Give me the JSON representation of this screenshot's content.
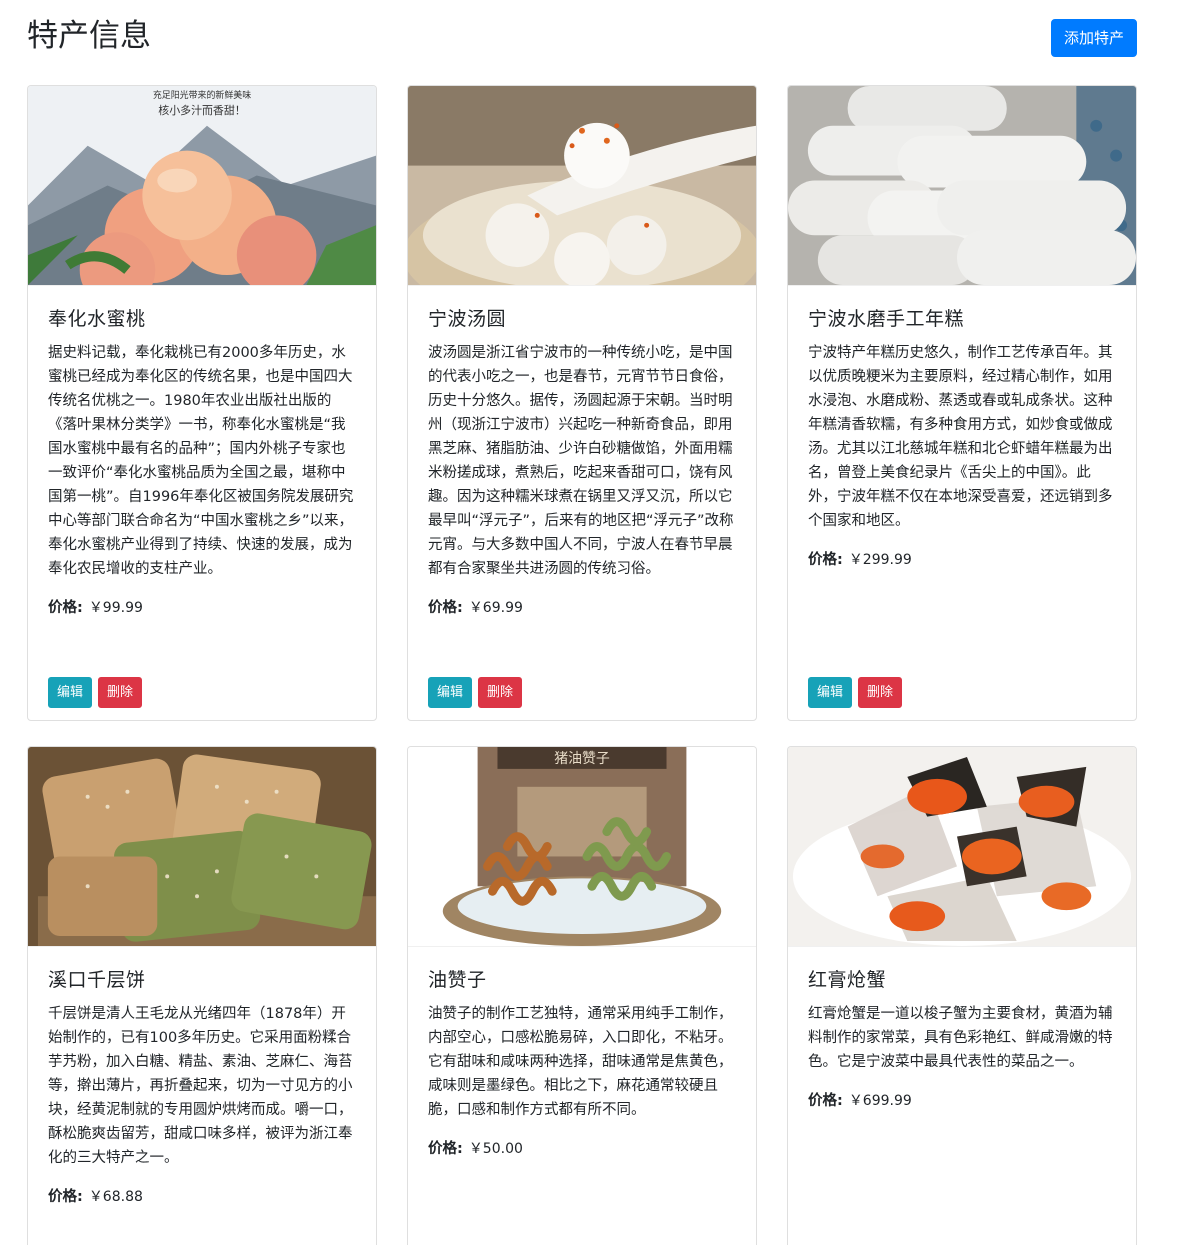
{
  "page": {
    "title": "特产信息",
    "add_button": "添加特产"
  },
  "common": {
    "price_label": "价格:",
    "edit_label": "编辑",
    "delete_label": "删除"
  },
  "colors": {
    "primary": "#007bff",
    "info": "#17a2b8",
    "danger": "#dc3545"
  },
  "products": [
    {
      "name": "奉化水蜜桃",
      "description": "据史料记载，奉化栽桃已有2000多年历史，水蜜桃已经成为奉化区的传统名果，也是中国四大传统名优桃之一。1980年农业出版社出版的《落叶果林分类学》一书，称奉化水蜜桃是“我国水蜜桃中最有名的品种”；国内外桃子专家也一致评价“奉化水蜜桃品质为全国之最，堪称中国第一桃”。自1996年奉化区被国务院发展研究中心等部门联合命名为“中国水蜜桃之乡”以来，奉化水蜜桃产业得到了持续、快速的发展，成为奉化农民增收的支柱产业。",
      "price": "￥99.99",
      "image_caption_1": "充足阳光带来的新鲜美味",
      "image_caption_2": "核小多汁而香甜！"
    },
    {
      "name": "宁波汤圆",
      "description": "波汤圆是浙江省宁波市的一种传统小吃，是中国的代表小吃之一，也是春节，元宵节节日食俗，历史十分悠久。据传，汤圆起源于宋朝。当时明州（现浙江宁波市）兴起吃一种新奇食品，即用黑芝麻、猪脂肪油、少许白砂糖做馅，外面用糯米粉搓成球，煮熟后，吃起来香甜可口，饶有风趣。因为这种糯米球煮在锅里又浮又沉，所以它最早叫“浮元子”，后来有的地区把“浮元子”改称元宵。与大多数中国人不同，宁波人在春节早晨都有合家聚坐共进汤圆的传统习俗。",
      "price": "￥69.99"
    },
    {
      "name": "宁波水磨手工年糕",
      "description": "宁波特产年糕历史悠久，制作工艺传承百年。其以优质晚粳米为主要原料，经过精心制作，如用水浸泡、水磨成粉、蒸透或春或轧成条状。这种年糕清香软糯，有多种食用方式，如炒食或做成汤。尤其以江北慈城年糕和北仑虾蜡年糕最为出名，曾登上美食纪录片《舌尖上的中国》。此外，宁波年糕不仅在本地深受喜爱，还远销到多个国家和地区。",
      "price": "￥299.99"
    },
    {
      "name": "溪口千层饼",
      "description": "千层饼是清人王毛龙从光绪四年（1878年）开始制作的，已有100多年历史。它采用面粉糅合芋艿粉，加入白糖、精盐、素油、芝麻仁、海苔等，擀出薄片，再折叠起来，切为一寸见方的小块，经黄泥制就的专用圆炉烘烤而成。嚼一口，酥松脆爽齿留芳，甜咸口味多样，被评为浙江奉化的三大特产之一。",
      "price": "￥68.88"
    },
    {
      "name": "油赞子",
      "description": "油赞子的制作工艺独特，通常采用纯手工制作，内部空心，口感松脆易碎，入口即化，不粘牙。 它有甜味和咸味两种选择，甜味通常是焦黄色，咸味则是墨绿色。相比之下，麻花通常较硬且脆，口感和制作方式都有所不同。",
      "price": "￥50.00",
      "image_caption_1": "猪油赞子"
    },
    {
      "name": "红膏炝蟹",
      "description": "红膏炝蟹是一道以梭子蟹为主要食材，黄酒为辅料制作的家常菜，具有色彩艳红、鲜咸滑嫩的特色。它是宁波菜中最具代表性的菜品之一。",
      "price": "￥699.99"
    }
  ]
}
